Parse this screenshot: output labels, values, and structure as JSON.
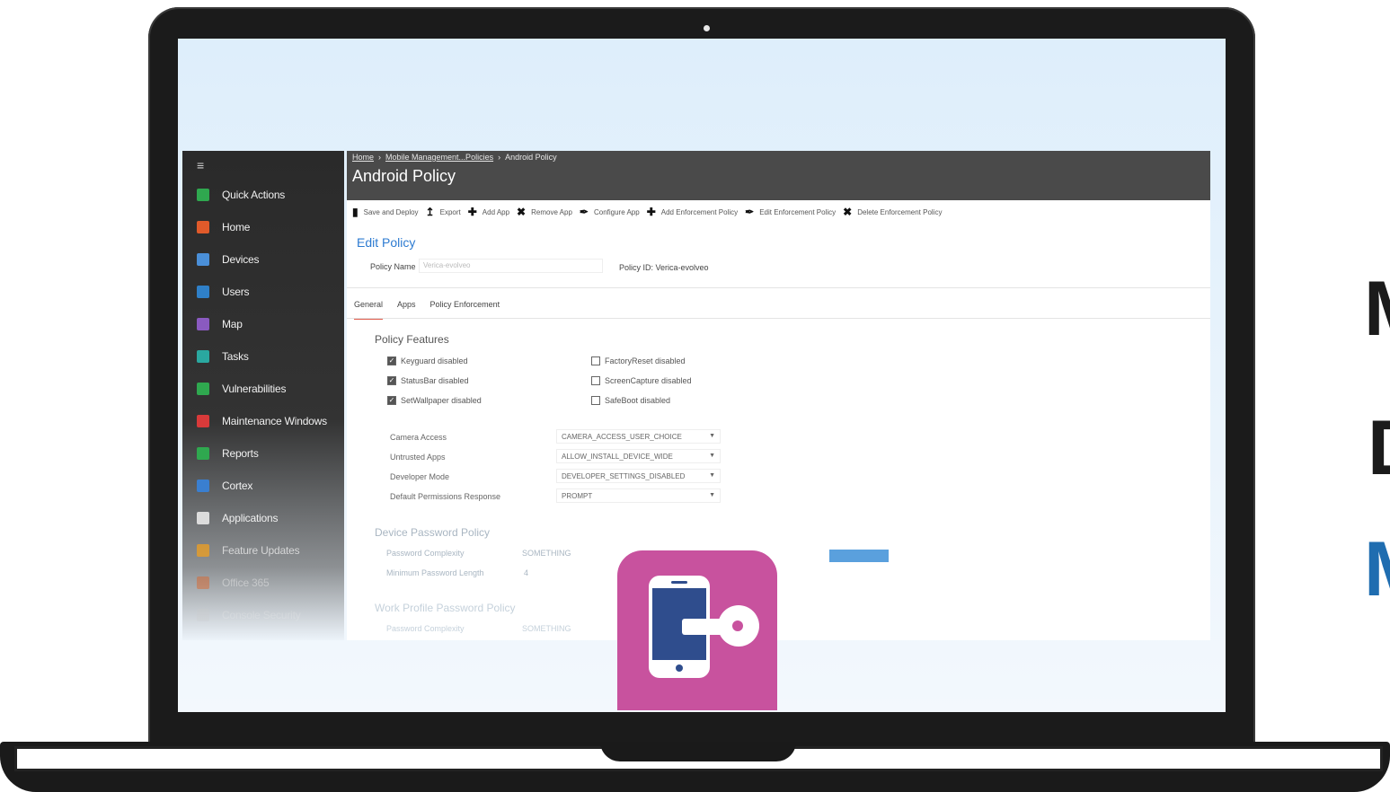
{
  "sidebar": {
    "menu_icon": "hamburger-icon",
    "items": [
      {
        "label": "Quick Actions",
        "icon": "plus-icon",
        "color": "#2fa84f"
      },
      {
        "label": "Home",
        "icon": "home-icon",
        "color": "#e05a2a"
      },
      {
        "label": "Devices",
        "icon": "monitor-icon",
        "color": "#4a8fd8"
      },
      {
        "label": "Users",
        "icon": "user-icon",
        "color": "#2f80c8"
      },
      {
        "label": "Map",
        "icon": "map-icon",
        "color": "#8a5ac0"
      },
      {
        "label": "Tasks",
        "icon": "tasks-icon",
        "color": "#2aa8a0"
      },
      {
        "label": "Vulnerabilities",
        "icon": "shield-icon",
        "color": "#2fa84f"
      },
      {
        "label": "Maintenance Windows",
        "icon": "x-icon",
        "color": "#d83a3a"
      },
      {
        "label": "Reports",
        "icon": "chart-icon",
        "color": "#2fa84f"
      },
      {
        "label": "Cortex",
        "icon": "cortex-icon",
        "color": "#3a7fd0"
      },
      {
        "label": "Applications",
        "icon": "window-icon",
        "color": "#dcdcdc"
      },
      {
        "label": "Feature Updates",
        "icon": "windows-icon",
        "color": "#f0a020"
      },
      {
        "label": "Office 365",
        "icon": "office-icon",
        "color": "#e06020"
      },
      {
        "label": "Console Security",
        "icon": "lock-icon",
        "color": "#cccccc"
      }
    ]
  },
  "breadcrumb": {
    "home": "Home",
    "section": "Mobile Management...Policies",
    "current": "Android Policy"
  },
  "header": {
    "title": "Android Policy"
  },
  "toolbar": [
    {
      "label": "Save and Deploy",
      "icon": "save-icon"
    },
    {
      "label": "Export",
      "icon": "export-icon"
    },
    {
      "label": "Add App",
      "icon": "plus-icon"
    },
    {
      "label": "Remove App",
      "icon": "remove-icon"
    },
    {
      "label": "Configure App",
      "icon": "wrench-icon"
    },
    {
      "label": "Add Enforcement Policy",
      "icon": "plus-icon"
    },
    {
      "label": "Edit Enforcement Policy",
      "icon": "wrench-icon"
    },
    {
      "label": "Delete Enforcement Policy",
      "icon": "remove-icon"
    }
  ],
  "edit": {
    "title": "Edit Policy",
    "policy_name_label": "Policy Name",
    "policy_name_value": "Verica-evolveo",
    "policy_id_label": "Policy ID:",
    "policy_id_value": "Verica-evolveo"
  },
  "tabs": [
    "General",
    "Apps",
    "Policy Enforcement"
  ],
  "features": {
    "title": "Policy Features",
    "left": [
      {
        "label": "Keyguard disabled",
        "checked": true
      },
      {
        "label": "StatusBar disabled",
        "checked": true
      },
      {
        "label": "SetWallpaper disabled",
        "checked": true
      }
    ],
    "right": [
      {
        "label": "FactoryReset disabled",
        "checked": false
      },
      {
        "label": "ScreenCapture disabled",
        "checked": false
      },
      {
        "label": "SafeBoot disabled",
        "checked": false
      }
    ]
  },
  "settings": [
    {
      "label": "Camera Access",
      "value": "CAMERA_ACCESS_USER_CHOICE"
    },
    {
      "label": "Untrusted Apps",
      "value": "ALLOW_INSTALL_DEVICE_WIDE"
    },
    {
      "label": "Developer Mode",
      "value": "DEVELOPER_SETTINGS_DISABLED"
    },
    {
      "label": "Default Permissions Response",
      "value": "PROMPT"
    }
  ],
  "device_password": {
    "title": "Device Password Policy",
    "complexity_label": "Password Complexity",
    "complexity_value": "SOMETHING",
    "min_length_label": "Minimum Password Length",
    "min_length_value": "4"
  },
  "work_profile": {
    "title": "Work Profile Password Policy",
    "complexity_label": "Password Complexity",
    "complexity_value": "SOMETHING"
  },
  "overlay_icon": {
    "name": "mobile-key-icon",
    "color": "#c8529e"
  }
}
